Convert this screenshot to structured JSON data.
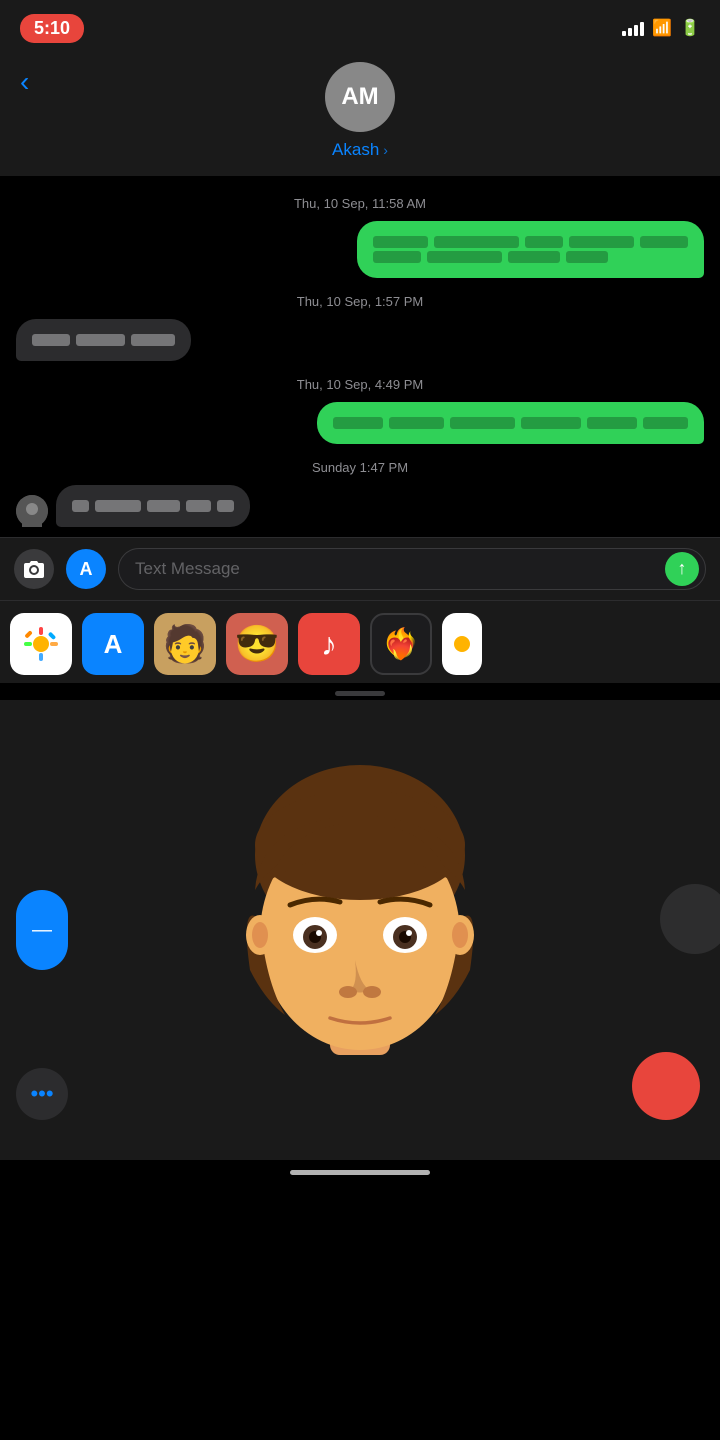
{
  "statusBar": {
    "time": "5:10",
    "signalDots": [
      4,
      7,
      10,
      13,
      16
    ],
    "wifiSymbol": "wifi",
    "batterySymbol": "battery"
  },
  "header": {
    "backLabel": "‹",
    "avatarInitials": "AM",
    "contactName": "Akash",
    "chevron": "›"
  },
  "messages": [
    {
      "timestamp": "Thu, 10 Sep, 11:58 AM",
      "type": "sent",
      "redactedLines": [
        [
          60,
          90,
          40,
          70,
          50
        ],
        [
          50,
          80,
          55,
          45
        ]
      ]
    },
    {
      "timestamp": "Thu, 10 Sep, 1:57 PM",
      "type": "received",
      "redactedLines": [
        [
          70,
          90,
          80
        ]
      ]
    },
    {
      "timestamp": "Thu, 10 Sep, 4:49 PM",
      "type": "sent",
      "redactedLines": [
        [
          55,
          60,
          70,
          65,
          55,
          50
        ]
      ]
    },
    {
      "timestamp": "Sunday 1:47 PM",
      "type": "received",
      "redactedLines": [
        [
          30,
          80,
          60,
          45,
          30
        ]
      ]
    }
  ],
  "inputBar": {
    "cameraLabel": "📷",
    "appstoreLabel": "A",
    "placeholder": "Text Message",
    "sendArrow": "↑"
  },
  "trayIcons": [
    {
      "label": "Photos",
      "bg": "#fff",
      "emoji": "🖼️"
    },
    {
      "label": "AppStore",
      "bg": "#0a84ff",
      "emoji": "A"
    },
    {
      "label": "Memoji1",
      "bg": "#f0d080",
      "emoji": "🧑"
    },
    {
      "label": "Memoji2",
      "bg": "#e87070",
      "emoji": "😎"
    },
    {
      "label": "Music",
      "bg": "#e8453c",
      "emoji": "♪"
    },
    {
      "label": "Heart",
      "bg": "#1c1c1e",
      "emoji": "❤️"
    },
    {
      "label": "Photos2",
      "bg": "#fff",
      "emoji": "🖼️"
    }
  ],
  "memojiPanel": {
    "faceDescription": "memoji male face with brown hair",
    "moreLabel": "•••",
    "recordLabel": ""
  }
}
